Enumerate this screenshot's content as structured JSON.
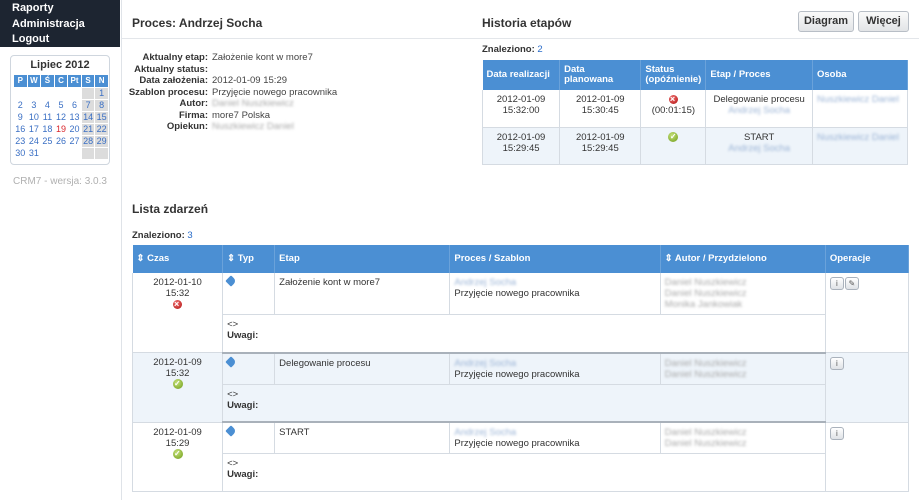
{
  "nav": {
    "items": [
      "Raporty",
      "Administracja",
      "Logout"
    ]
  },
  "calendar": {
    "title": "Lipiec 2012",
    "weekdays": [
      "P",
      "W",
      "Ś",
      "C",
      "Pt",
      "S",
      "N"
    ],
    "weeks": [
      [
        "",
        "",
        "",
        "",
        "",
        "",
        "1"
      ],
      [
        "2",
        "3",
        "4",
        "5",
        "6",
        "7",
        "8"
      ],
      [
        "9",
        "10",
        "11",
        "12",
        "13",
        "14",
        "15"
      ],
      [
        "16",
        "17",
        "18",
        "19",
        "20",
        "21",
        "22"
      ],
      [
        "23",
        "24",
        "25",
        "26",
        "27",
        "28",
        "29"
      ],
      [
        "30",
        "31",
        "",
        "",
        "",
        "",
        ""
      ]
    ],
    "today": "19"
  },
  "version": "CRM7 - wersja: 3.0.3",
  "process": {
    "title": "Proces: Andrzej Socha",
    "fields": [
      {
        "label": "Aktualny etap:",
        "value": "Założenie kont w more7"
      },
      {
        "label": "Aktualny status:",
        "value": ""
      },
      {
        "label": "Data założenia:",
        "value": "2012-01-09 15:29"
      },
      {
        "label": "Szablon procesu:",
        "value": "Przyjęcie nowego pracownika"
      },
      {
        "label": "Autor:",
        "value": "Daniel Nuszkiewicz"
      },
      {
        "label": "Firma:",
        "value": "more7 Polska"
      },
      {
        "label": "Opiekun:",
        "value": "Nuszkiewicz Daniel"
      }
    ]
  },
  "history": {
    "title": "Historia etapów",
    "found_label": "Znaleziono:",
    "found_count": "2",
    "buttons": {
      "diagram": "Diagram",
      "more": "Więcej"
    },
    "columns": [
      "Data realizacji",
      "Data planowana",
      "Status (opóźnienie)",
      "Etap / Proces",
      "Osoba"
    ],
    "rows": [
      {
        "realized": "2012-01-09 15:32:00",
        "planned": "2012-01-09 15:30:45",
        "status": "error",
        "delay": "(00:01:15)",
        "stage": "Delegowanie procesu",
        "process": "Andrzej Socha",
        "person": "Nuszkiewicz Daniel"
      },
      {
        "realized": "2012-01-09 15:29:45",
        "planned": "2012-01-09 15:29:45",
        "status": "ok",
        "delay": "",
        "stage": "START",
        "process": "Andrzej Socha",
        "person": "Nuszkiewicz Daniel"
      }
    ]
  },
  "events": {
    "title": "Lista zdarzeń",
    "found_label": "Znaleziono:",
    "found_count": "3",
    "columns": [
      "Czas",
      "Typ",
      "Etap",
      "Proces / Szablon",
      "Autor / Przydzielono",
      "Operacje"
    ],
    "notes_label": "Uwagi:",
    "expand_glyph": "<>",
    "rows": [
      {
        "date": "2012-01-10",
        "time": "15:32",
        "status": "error",
        "stage": "Założenie kont w more7",
        "process": "Andrzej Socha",
        "template": "Przyjęcie nowego pracownika",
        "people": [
          "Daniel Nuszkiewicz",
          "Daniel Nuszkiewicz",
          "Monika Jankowiak"
        ],
        "ops": [
          "info",
          "edit"
        ]
      },
      {
        "date": "2012-01-09",
        "time": "15:32",
        "status": "ok",
        "stage": "Delegowanie procesu",
        "process": "Andrzej Socha",
        "template": "Przyjęcie nowego pracownika",
        "people": [
          "Daniel Nuszkiewicz",
          "Daniel Nuszkiewicz"
        ],
        "ops": [
          "info"
        ]
      },
      {
        "date": "2012-01-09",
        "time": "15:29",
        "status": "ok",
        "stage": "START",
        "process": "Andrzej Socha",
        "template": "Przyjęcie nowego pracownika",
        "people": [
          "Daniel Nuszkiewicz",
          "Daniel Nuszkiewicz"
        ],
        "ops": [
          "info"
        ]
      }
    ]
  }
}
